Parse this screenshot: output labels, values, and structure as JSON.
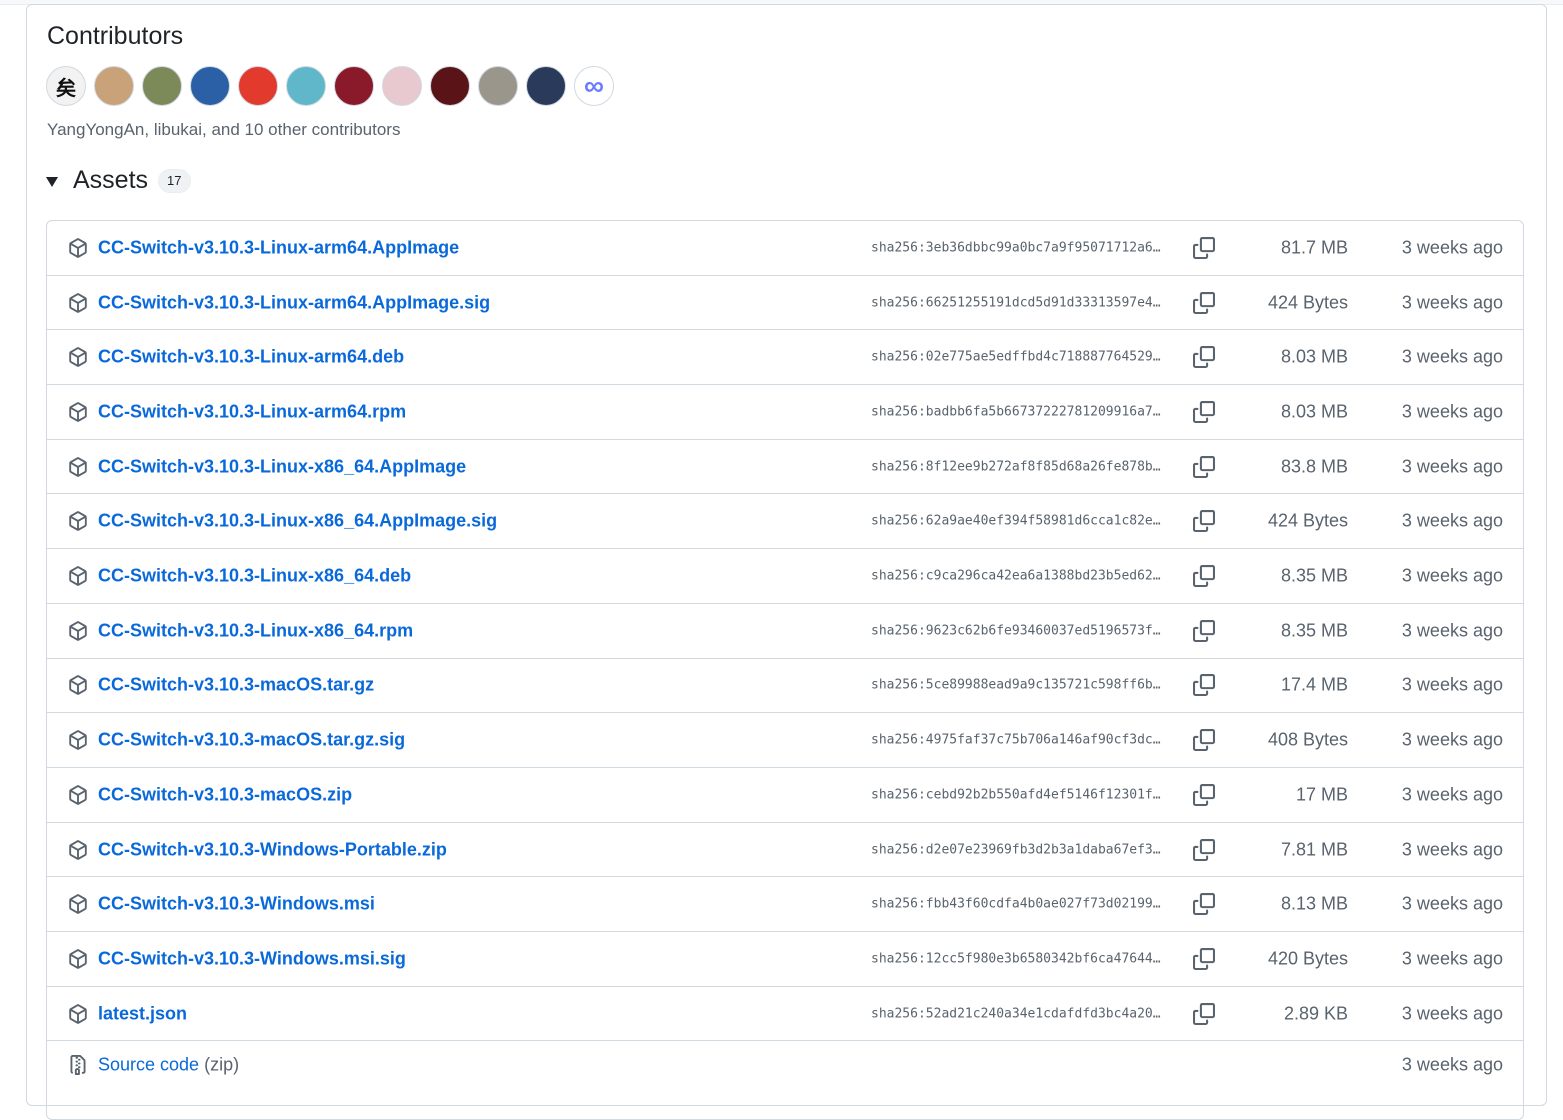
{
  "contributors": {
    "title": "Contributors",
    "summary": "YangYongAn, libukai, and 10 other contributors",
    "avatars": [
      {
        "name": "avatar-1",
        "color": "#f2f2f2",
        "glyph": "矣"
      },
      {
        "name": "avatar-2",
        "color": "#c9a27a",
        "glyph": ""
      },
      {
        "name": "avatar-3",
        "color": "#7c8a5a",
        "glyph": ""
      },
      {
        "name": "avatar-4",
        "color": "#2b5fa6",
        "glyph": ""
      },
      {
        "name": "avatar-5",
        "color": "#e23b2e",
        "glyph": ""
      },
      {
        "name": "avatar-6",
        "color": "#5fb7c9",
        "glyph": ""
      },
      {
        "name": "avatar-7",
        "color": "#8a1a2a",
        "glyph": ""
      },
      {
        "name": "avatar-8",
        "color": "#e8c9cf",
        "glyph": ""
      },
      {
        "name": "avatar-9",
        "color": "#5a1418",
        "glyph": ""
      },
      {
        "name": "avatar-10",
        "color": "#9a968c",
        "glyph": ""
      },
      {
        "name": "avatar-11",
        "color": "#2a3a5a",
        "glyph": ""
      },
      {
        "name": "avatar-12",
        "color": "#ffffff",
        "glyph": "∞"
      }
    ]
  },
  "assets": {
    "title": "Assets",
    "count": "17",
    "rows": [
      {
        "name": "CC-Switch-v3.10.3-Linux-arm64.AppImage",
        "sha": "sha256:3eb36dbbc99a0bc7a9f95071712a6…",
        "size": "81.7 MB",
        "date": "3 weeks ago"
      },
      {
        "name": "CC-Switch-v3.10.3-Linux-arm64.AppImage.sig",
        "sha": "sha256:66251255191dcd5d91d33313597e4…",
        "size": "424 Bytes",
        "date": "3 weeks ago"
      },
      {
        "name": "CC-Switch-v3.10.3-Linux-arm64.deb",
        "sha": "sha256:02e775ae5edffbd4c718887764529…",
        "size": "8.03 MB",
        "date": "3 weeks ago"
      },
      {
        "name": "CC-Switch-v3.10.3-Linux-arm64.rpm",
        "sha": "sha256:badbb6fa5b66737222781209916a7…",
        "size": "8.03 MB",
        "date": "3 weeks ago"
      },
      {
        "name": "CC-Switch-v3.10.3-Linux-x86_64.AppImage",
        "sha": "sha256:8f12ee9b272af8f85d68a26fe878b…",
        "size": "83.8 MB",
        "date": "3 weeks ago"
      },
      {
        "name": "CC-Switch-v3.10.3-Linux-x86_64.AppImage.sig",
        "sha": "sha256:62a9ae40ef394f58981d6cca1c82e…",
        "size": "424 Bytes",
        "date": "3 weeks ago"
      },
      {
        "name": "CC-Switch-v3.10.3-Linux-x86_64.deb",
        "sha": "sha256:c9ca296ca42ea6a1388bd23b5ed62…",
        "size": "8.35 MB",
        "date": "3 weeks ago"
      },
      {
        "name": "CC-Switch-v3.10.3-Linux-x86_64.rpm",
        "sha": "sha256:9623c62b6fe93460037ed5196573f…",
        "size": "8.35 MB",
        "date": "3 weeks ago"
      },
      {
        "name": "CC-Switch-v3.10.3-macOS.tar.gz",
        "sha": "sha256:5ce89988ead9a9c135721c598ff6b…",
        "size": "17.4 MB",
        "date": "3 weeks ago"
      },
      {
        "name": "CC-Switch-v3.10.3-macOS.tar.gz.sig",
        "sha": "sha256:4975faf37c75b706a146af90cf3dc…",
        "size": "408 Bytes",
        "date": "3 weeks ago"
      },
      {
        "name": "CC-Switch-v3.10.3-macOS.zip",
        "sha": "sha256:cebd92b2b550afd4ef5146f12301f…",
        "size": "17 MB",
        "date": "3 weeks ago"
      },
      {
        "name": "CC-Switch-v3.10.3-Windows-Portable.zip",
        "sha": "sha256:d2e07e23969fb3d2b3a1daba67ef3…",
        "size": "7.81 MB",
        "date": "3 weeks ago"
      },
      {
        "name": "CC-Switch-v3.10.3-Windows.msi",
        "sha": "sha256:fbb43f60cdfa4b0ae027f73d02199…",
        "size": "8.13 MB",
        "date": "3 weeks ago"
      },
      {
        "name": "CC-Switch-v3.10.3-Windows.msi.sig",
        "sha": "sha256:12cc5f980e3b6580342bf6ca47644…",
        "size": "420 Bytes",
        "date": "3 weeks ago"
      },
      {
        "name": "latest.json",
        "sha": "sha256:52ad21c240a34e1cdafdfd3bc4a20…",
        "size": "2.89 KB",
        "date": "3 weeks ago"
      }
    ],
    "source": {
      "name": "Source code",
      "suffix": "(zip)",
      "date": "3 weeks ago"
    }
  }
}
